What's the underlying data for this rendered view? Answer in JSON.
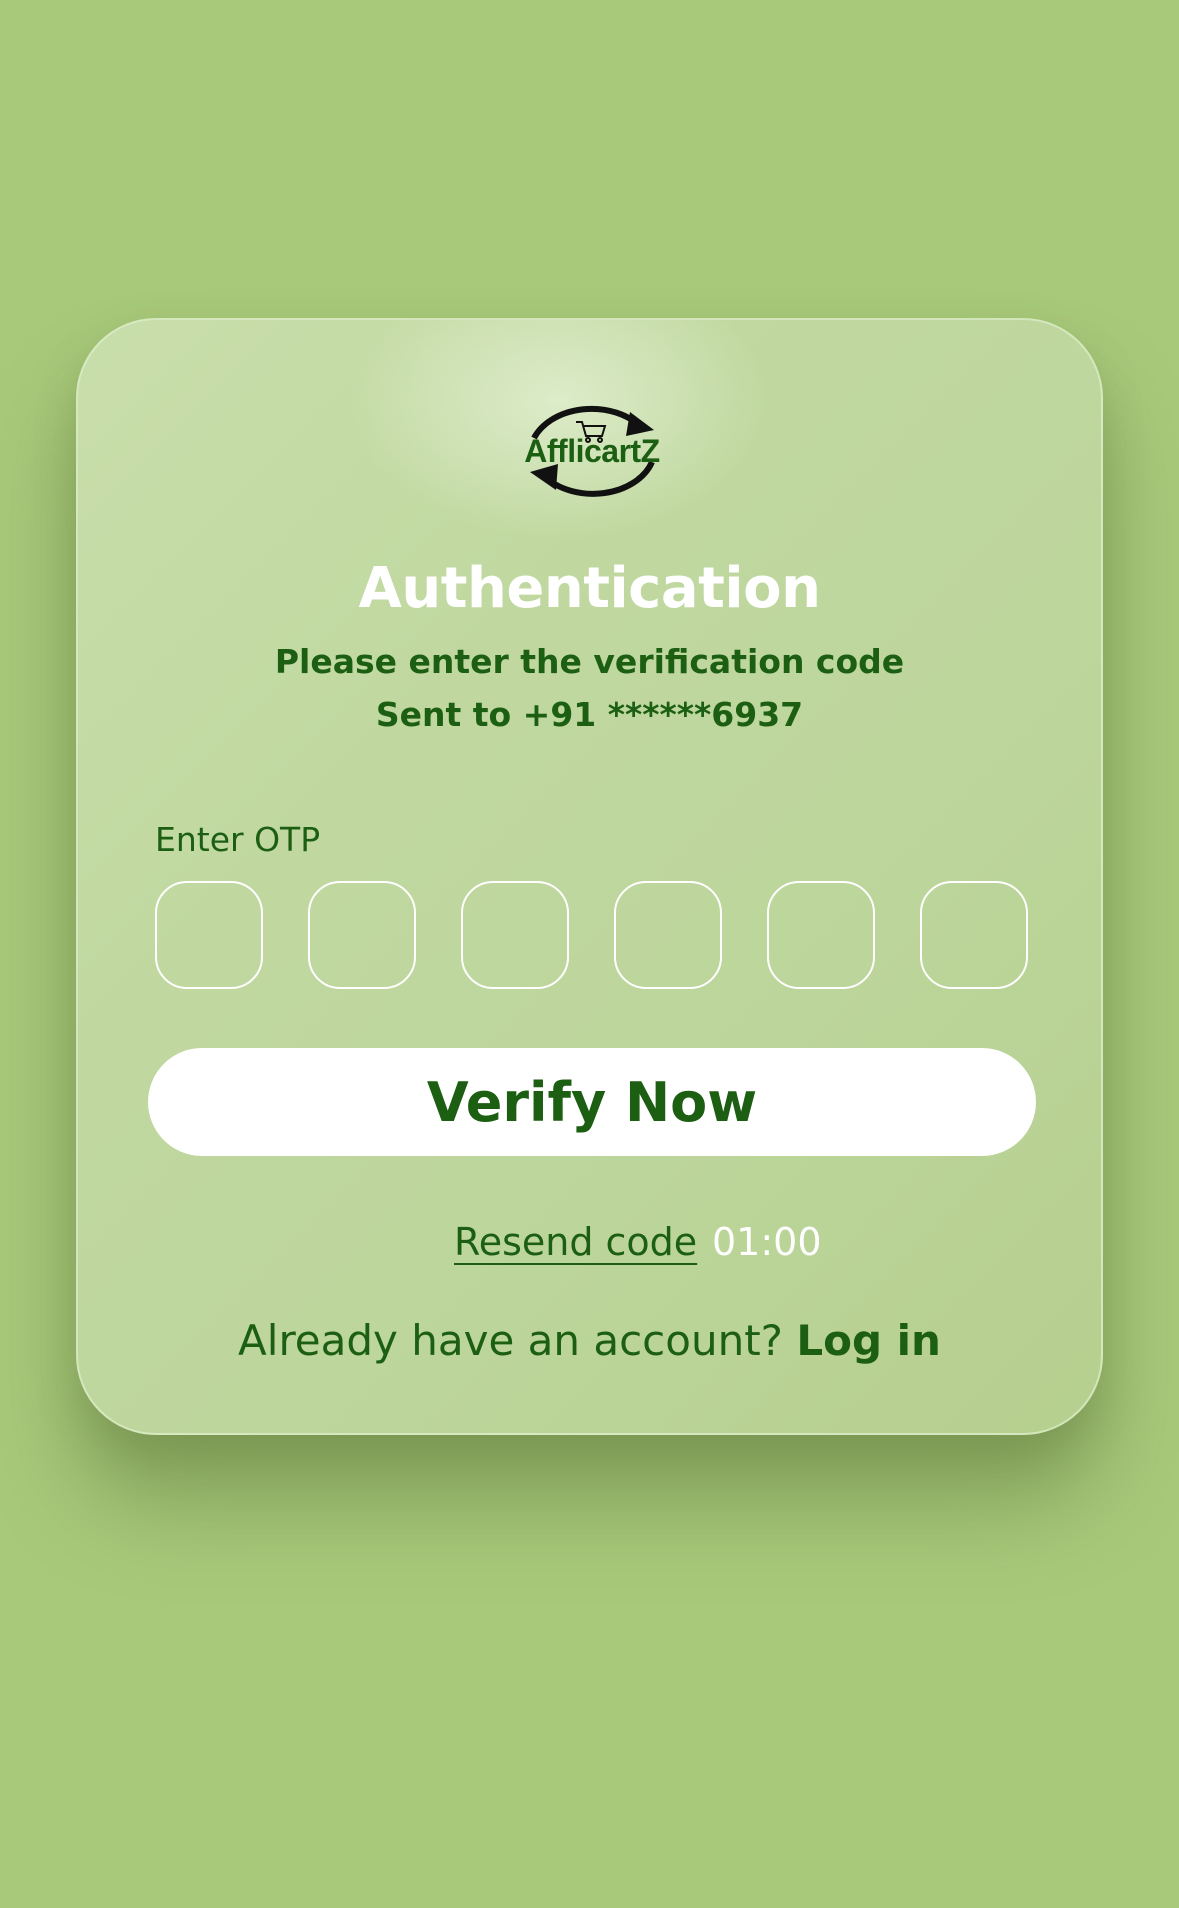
{
  "brand": {
    "logo_text": "AfflicartZ"
  },
  "auth": {
    "title": "Authentication",
    "subtitle_line1": "Please enter the verification code",
    "subtitle_line2": "Sent to +91 ******6937"
  },
  "otp": {
    "label": "Enter OTP",
    "digits": [
      "",
      "",
      "",
      "",
      "",
      ""
    ]
  },
  "actions": {
    "verify_label": "Verify Now",
    "resend_label": "Resend code",
    "timer": "01:00"
  },
  "footer": {
    "prompt": "Already have an account?",
    "login_label": "Log in"
  },
  "colors": {
    "background": "#a8c97a",
    "primary_text": "#1c5f12",
    "title_text": "#ffffff",
    "button_bg": "#ffffff"
  }
}
